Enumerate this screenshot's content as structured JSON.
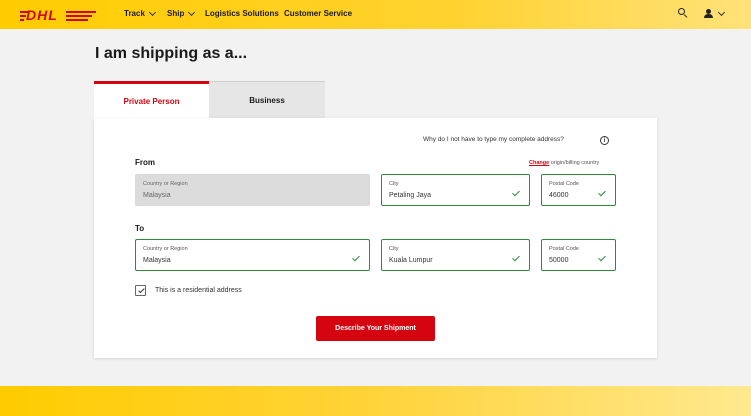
{
  "brand": {
    "logo_text": "DHL",
    "primary_color": "#d40511",
    "header_color": "#ffcc00",
    "success_color": "#2f8a3e"
  },
  "header": {
    "nav": [
      {
        "label": "Track",
        "has_dropdown": true
      },
      {
        "label": "Ship",
        "has_dropdown": true
      },
      {
        "label": "Logistics Solutions",
        "has_dropdown": false
      },
      {
        "label": "Customer Service",
        "has_dropdown": false
      }
    ],
    "icons": [
      "search-icon",
      "user-icon",
      "chevron-down-icon"
    ]
  },
  "page": {
    "title": "I am shipping as a..."
  },
  "tabs": [
    {
      "label": "Private Person",
      "active": true
    },
    {
      "label": "Business",
      "active": false
    }
  ],
  "form": {
    "hint": "Why do I not have to type my complete address?",
    "from": {
      "label": "From",
      "change_link": "Change",
      "change_suffix": " origin/billing country",
      "country": {
        "label": "Country or Region",
        "value": "Malaysia"
      },
      "city": {
        "label": "City",
        "value": "Petaling Jaya"
      },
      "postal": {
        "label": "Postal Code",
        "value": "46000"
      }
    },
    "to": {
      "label": "To",
      "country": {
        "label": "Country or Region",
        "value": "Malaysia"
      },
      "city": {
        "label": "City",
        "value": "Kuala Lumpur"
      },
      "postal": {
        "label": "Postal Code",
        "value": "50000"
      }
    },
    "residential": {
      "label": "This is a residential address",
      "checked": true
    },
    "submit_label": "Describe Your Shipment"
  }
}
